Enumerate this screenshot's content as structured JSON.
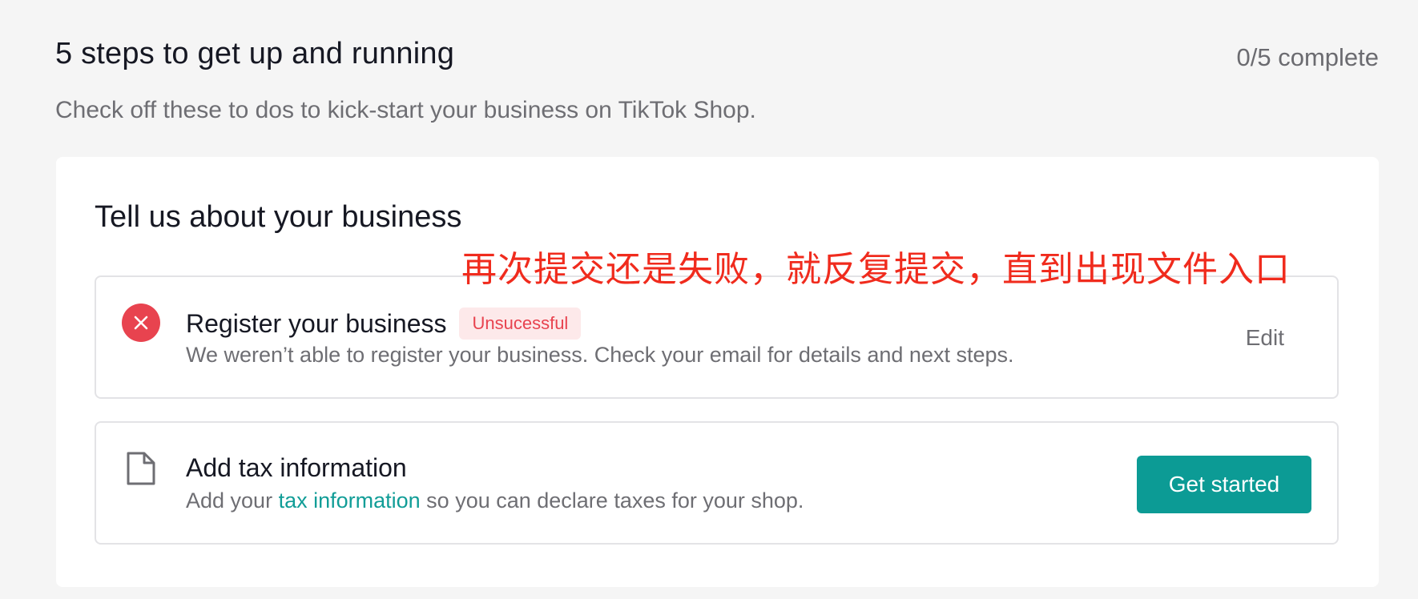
{
  "header": {
    "title": "5 steps to get up and running",
    "progress": "0/5 complete",
    "subtitle": "Check off these to dos to kick-start your business on TikTok Shop."
  },
  "section": {
    "title": "Tell us about your business"
  },
  "annotation": {
    "text": "再次提交还是失败，就反复提交，直到出现文件入口",
    "color": "#f02b1d"
  },
  "steps": [
    {
      "title": "Register your business",
      "badge": "Unsucessful",
      "description": "We weren’t able to register your business. Check your email for details and next steps.",
      "action_label": "Edit",
      "icon": "error-x-icon",
      "status_color": "#e8434f"
    },
    {
      "title": "Add tax information",
      "description_before": "Add your ",
      "description_link": "tax information",
      "description_after": " so you can declare taxes for your shop.",
      "action_label": "Get started",
      "icon": "document-icon",
      "accent_color": "#0c9b95"
    }
  ]
}
